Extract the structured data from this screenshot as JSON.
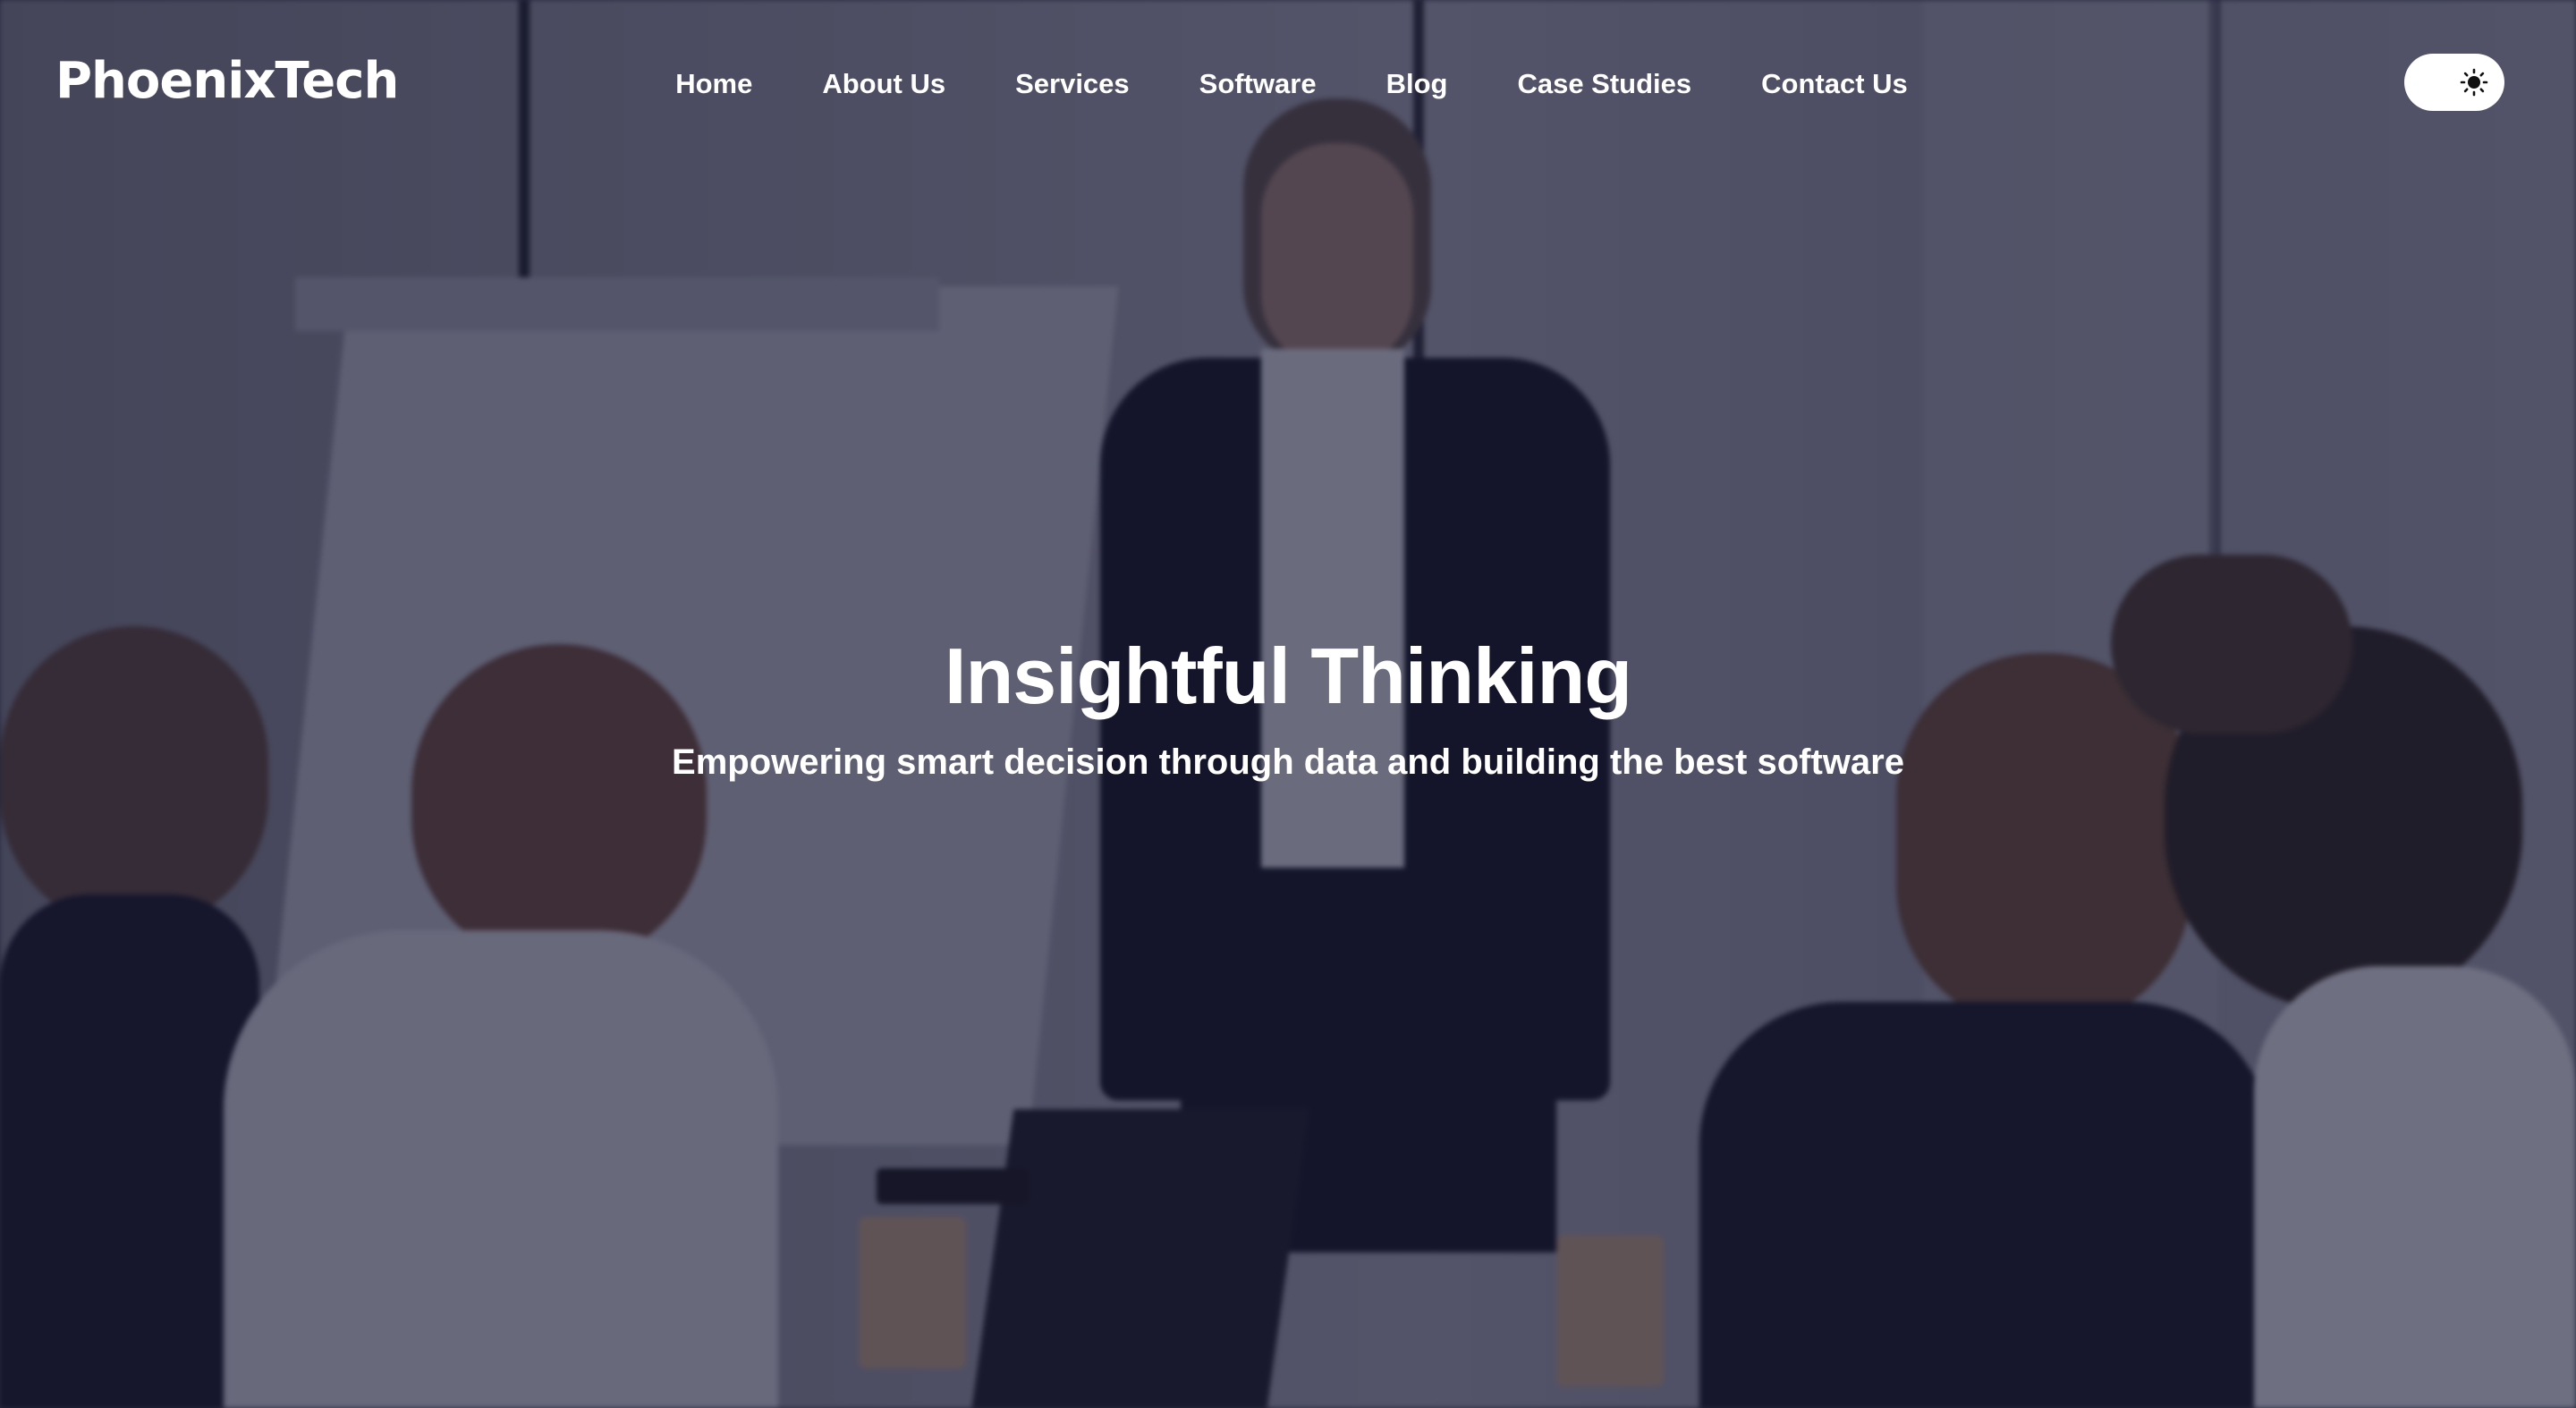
{
  "brand": {
    "logo_text": "PhoenixTech"
  },
  "nav": {
    "items": [
      {
        "label": "Home"
      },
      {
        "label": "About Us"
      },
      {
        "label": "Services"
      },
      {
        "label": "Software"
      },
      {
        "label": "Blog"
      },
      {
        "label": "Case Studies"
      },
      {
        "label": "Contact Us"
      }
    ]
  },
  "theme_toggle": {
    "icon": "sun-icon",
    "state": "light"
  },
  "hero": {
    "title": "Insightful Thinking",
    "subtitle": "Empowering smart decision through data and building the best software",
    "background": "meeting-presentation-photo"
  },
  "colors": {
    "text": "#ffffff",
    "overlay": "#181830",
    "toggle_bg": "#ffffff",
    "icon": "#111111"
  }
}
